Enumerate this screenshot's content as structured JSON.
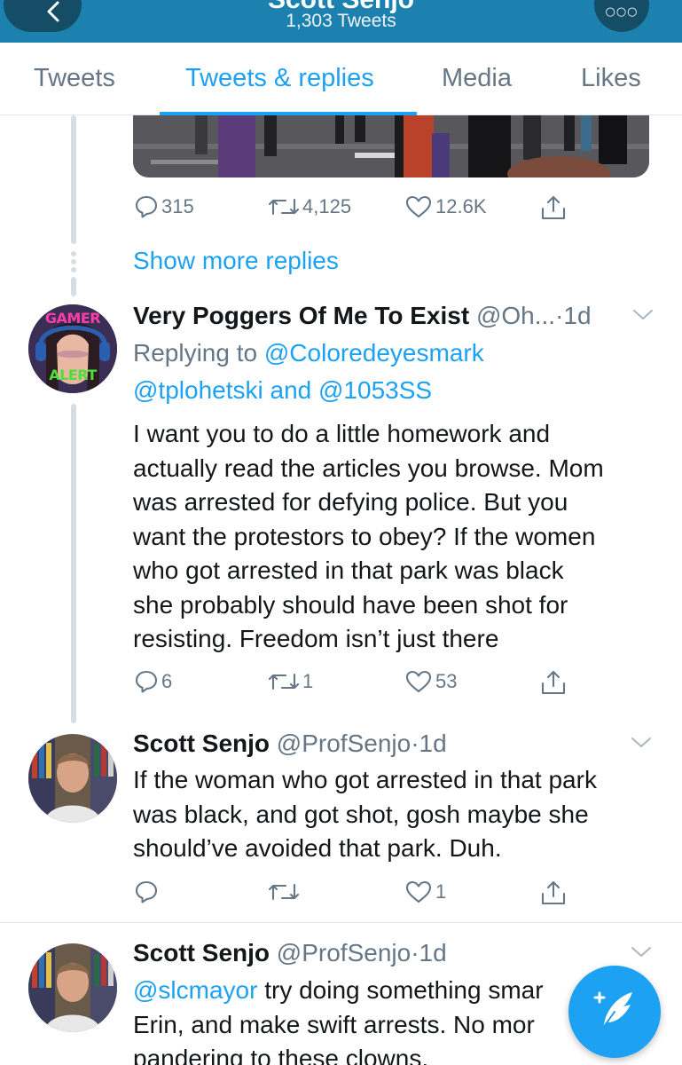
{
  "header": {
    "name": "Scott Senjo",
    "tweet_count": "1,303 Tweets"
  },
  "tabs": [
    {
      "label": "Tweets"
    },
    {
      "label": "Tweets & replies"
    },
    {
      "label": "Media"
    },
    {
      "label": "Likes"
    }
  ],
  "prev_tweet": {
    "replies": "315",
    "retweets": "4,125",
    "likes": "12.6K"
  },
  "show_more_replies": "Show more replies",
  "tweets": [
    {
      "name": "Very Poggers Of Me To Exist",
      "handle": "@Oh...",
      "time": "1d",
      "avatar_text_top": "GAMER",
      "avatar_text_bottom": "ALERT",
      "replying_to_label": "Replying to",
      "replying_to_user1": "@Coloredeyesmark",
      "replying_to_user2": "@tplohetski",
      "replying_to_and": "and",
      "replying_to_user3": "@1053SS",
      "text_lines": [
        "I want you to do a little homework and",
        "actually read the articles you browse. Mom",
        "was arrested for defying police. But you",
        "want the protestors to obey? If the women",
        "who got arrested in that park was black",
        "she probably should have been shot for",
        "resisting. Freedom isn’t just there"
      ],
      "replies": "6",
      "retweets": "1",
      "likes": "53"
    },
    {
      "name": "Scott Senjo",
      "handle": "@ProfSenjo",
      "time": "1d",
      "text_lines": [
        "If the woman who got arrested in that park",
        "was black, and got shot, gosh maybe she",
        "should’ve avoided that park.  Duh."
      ],
      "replies": "",
      "retweets": "",
      "likes": "1"
    },
    {
      "name": "Scott Senjo",
      "handle": "@ProfSenjo",
      "time": "1d",
      "mention": "@slcmayor",
      "text_line1_rest": "try doing something smar",
      "text_line2": "Erin, and make swift arrests.  No mor",
      "text_line3": "pandering to these clowns."
    }
  ],
  "colors": {
    "header_bg": "#1d81b0",
    "accent": "#1da1f2",
    "muted": "#657786"
  }
}
